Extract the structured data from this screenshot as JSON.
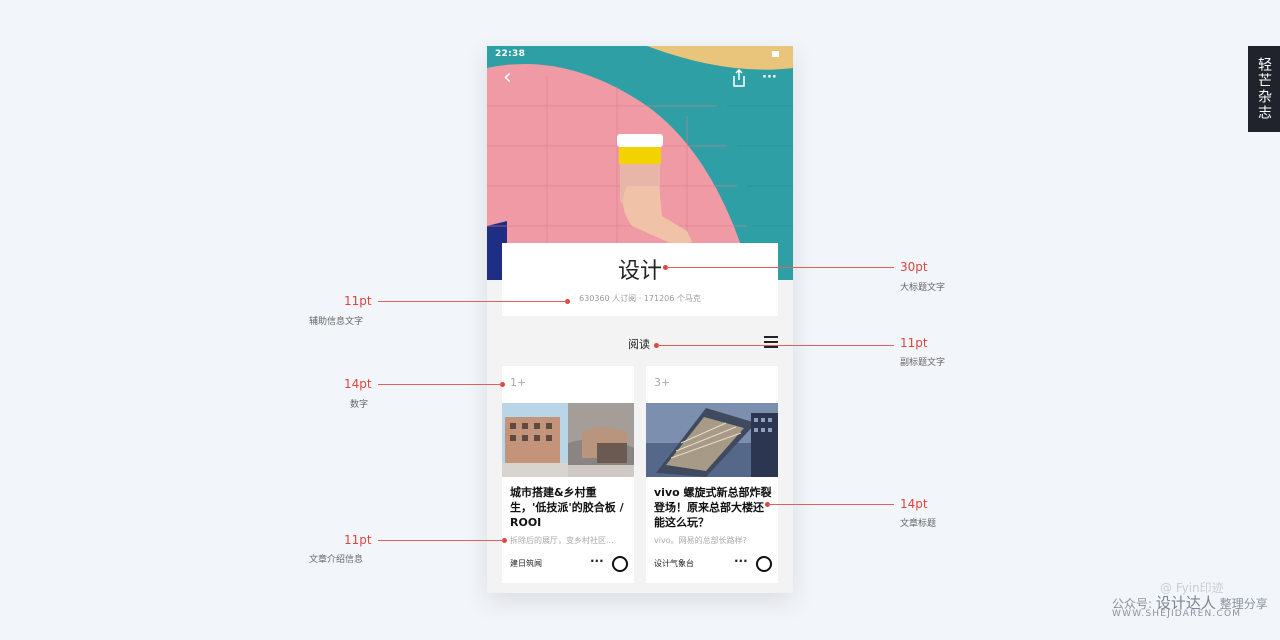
{
  "phone": {
    "status_time": "22:38",
    "nav": {
      "back_icon": "chevron-left-icon",
      "share_icon": "share-icon",
      "more_icon": "more-horizontal-icon",
      "back_glyph": "‹",
      "more_glyph": "···"
    },
    "header": {
      "title": "设计",
      "meta": "630360 人订阅 · 171206 个马克"
    },
    "section": {
      "label": "阅读",
      "menu_icon": "menu-icon"
    },
    "cards": [
      {
        "number": "1+",
        "title": "城市搭建&乡村重生，'低技派'的胶合板 / ROOI",
        "desc": "拆除后的展厅，变乡村社区...",
        "source": "建日筑闻",
        "more": "···"
      },
      {
        "number": "3+",
        "title": "vivo 螺旋式新总部炸裂登场！原来总部大楼还能这么玩？",
        "desc": "vivo。网易的总部长路样?",
        "source": "设计气象台",
        "more": "···"
      }
    ]
  },
  "annotations": {
    "title_size": {
      "value": "30pt",
      "desc": "大标题文字"
    },
    "meta_size": {
      "value": "11pt",
      "desc": "辅助信息文字"
    },
    "subtitle_size": {
      "value": "11pt",
      "desc": "副标题文字"
    },
    "number_size": {
      "value": "14pt",
      "desc": "数字"
    },
    "article_title_size": {
      "value": "14pt",
      "desc": "文章标题"
    },
    "article_intro_size": {
      "value": "11pt",
      "desc": "文章介绍信息"
    }
  },
  "side_tab": "轻芒杂志",
  "watermark": {
    "line1": "@ Fyin印迹",
    "line2_prefix": "公众号:",
    "line2_brand": "设计达人",
    "line2_suffix": "整理分享",
    "line3": "WWW.SHEJIDAREN.COM"
  },
  "colors": {
    "accent_red": "#e0443e",
    "teal": "#2e9fa5",
    "pink": "#ef9aa5",
    "cup_yellow": "#f2d200"
  }
}
